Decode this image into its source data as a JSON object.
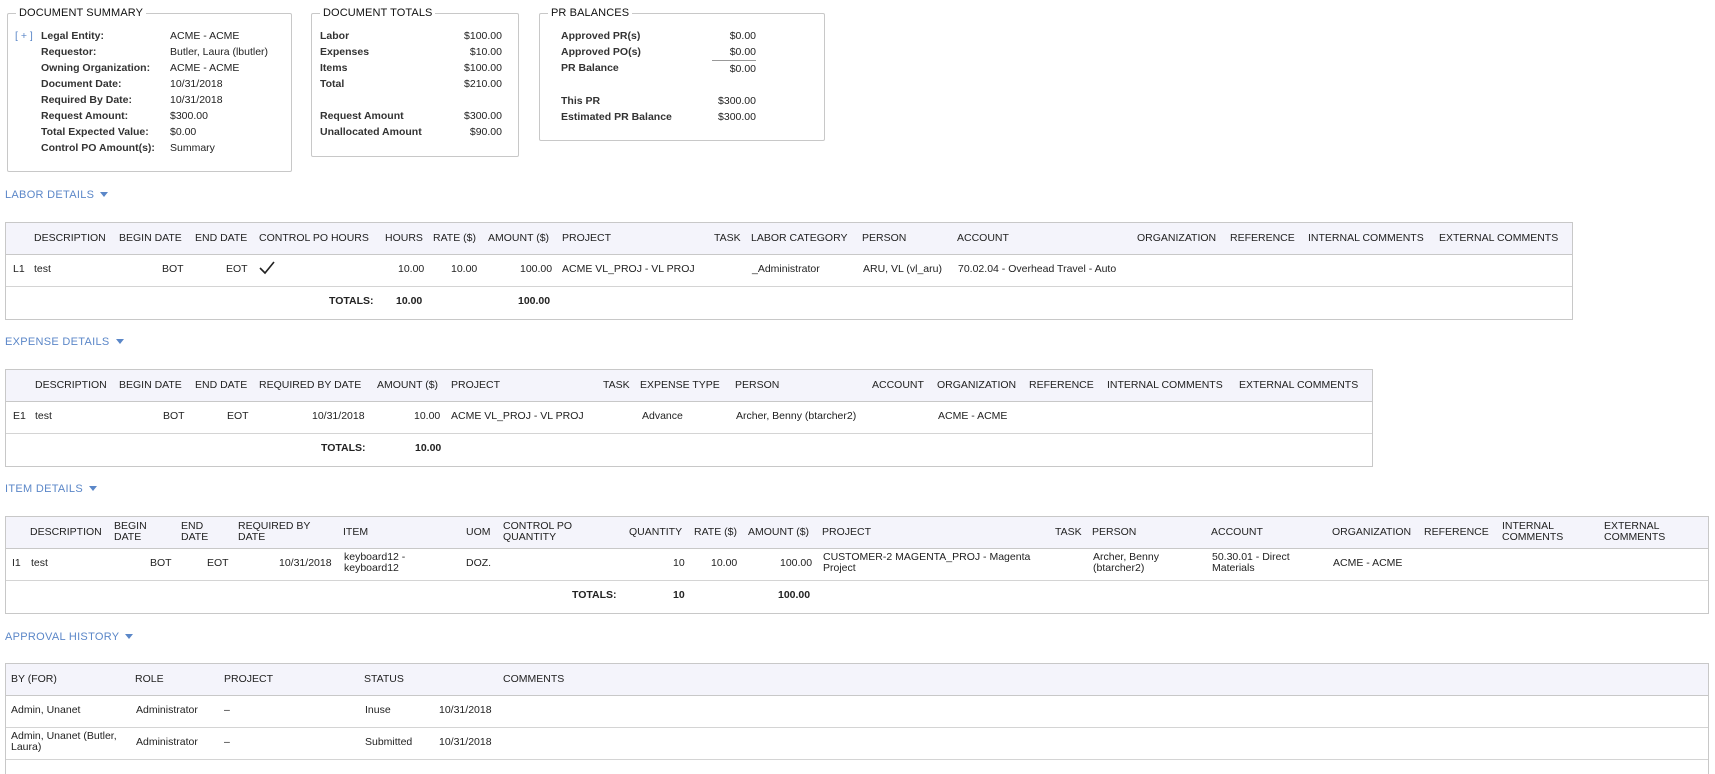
{
  "summary": {
    "title": "DOCUMENT SUMMARY",
    "expand_label": "[ + ]",
    "rows": [
      {
        "label": "Legal Entity:",
        "value": "ACME - ACME"
      },
      {
        "label": "Requestor:",
        "value": "Butler, Laura (lbutler)"
      },
      {
        "label": "Owning Organization:",
        "value": "ACME - ACME"
      },
      {
        "label": "Document Date:",
        "value": "10/31/2018"
      },
      {
        "label": "Required By Date:",
        "value": "10/31/2018"
      },
      {
        "label": "Request Amount:",
        "value": "$300.00"
      },
      {
        "label": "Total Expected Value:",
        "value": "$0.00"
      },
      {
        "label": "Control PO Amount(s):",
        "value": "Summary"
      }
    ]
  },
  "totals": {
    "title": "DOCUMENT TOTALS",
    "rows": [
      {
        "label": "Labor",
        "value": "$100.00"
      },
      {
        "label": "Expenses",
        "value": "$10.00"
      },
      {
        "label": "Items",
        "value": "$100.00"
      },
      {
        "label": "Total",
        "value": "$210.00"
      },
      {
        "label": "Request Amount",
        "value": "$300.00"
      },
      {
        "label": "Unallocated Amount",
        "value": "$90.00"
      }
    ]
  },
  "balances": {
    "title": "PR BALANCES",
    "rows": [
      {
        "label": "Approved PR(s)",
        "value": "$0.00"
      },
      {
        "label": "Approved PO(s)",
        "value": "$0.00"
      },
      {
        "label": "PR Balance",
        "value": "$0.00"
      },
      {
        "label": "This PR",
        "value": "$300.00"
      },
      {
        "label": "Estimated PR Balance",
        "value": "$300.00"
      }
    ]
  },
  "labor": {
    "section_label": "LABOR DETAILS",
    "headers": {
      "description": "DESCRIPTION",
      "begin_date": "BEGIN DATE",
      "end_date": "END DATE",
      "control_po_hours": "CONTROL PO HOURS",
      "hours": "HOURS",
      "rate": "RATE ($)",
      "amount": "AMOUNT ($)",
      "project": "PROJECT",
      "task": "TASK",
      "labor_category": "LABOR CATEGORY",
      "person": "PERSON",
      "account": "ACCOUNT",
      "organization": "ORGANIZATION",
      "reference": "REFERENCE",
      "internal_comments": "INTERNAL COMMENTS",
      "external_comments": "EXTERNAL COMMENTS"
    },
    "row": {
      "id": "L1",
      "description": "test",
      "begin_date": "BOT",
      "end_date": "EOT",
      "hours": "10.00",
      "rate": "10.00",
      "amount": "100.00",
      "project": "ACME VL_PROJ - VL PROJ",
      "labor_category": "_Administrator",
      "person": "ARU, VL (vl_aru)",
      "account": "70.02.04 - Overhead Travel - Auto"
    },
    "totals": {
      "label": "TOTALS:",
      "hours": "10.00",
      "amount": "100.00"
    }
  },
  "expense": {
    "section_label": "EXPENSE DETAILS",
    "headers": {
      "description": "DESCRIPTION",
      "begin_date": "BEGIN DATE",
      "end_date": "END DATE",
      "required_by_date": "REQUIRED BY DATE",
      "amount": "AMOUNT ($)",
      "project": "PROJECT",
      "task": "TASK",
      "expense_type": "EXPENSE TYPE",
      "person": "PERSON",
      "account": "ACCOUNT",
      "organization": "ORGANIZATION",
      "reference": "REFERENCE",
      "internal_comments": "INTERNAL COMMENTS",
      "external_comments": "EXTERNAL COMMENTS"
    },
    "row": {
      "id": "E1",
      "description": "test",
      "begin_date": "BOT",
      "end_date": "EOT",
      "required_by_date": "10/31/2018",
      "amount": "10.00",
      "project": "ACME VL_PROJ - VL PROJ",
      "expense_type": "Advance",
      "person": "Archer, Benny (btarcher2)",
      "organization": "ACME - ACME"
    },
    "totals": {
      "label": "TOTALS:",
      "amount": "10.00"
    }
  },
  "item": {
    "section_label": "ITEM DETAILS",
    "headers": {
      "description": "DESCRIPTION",
      "begin_date": "BEGIN DATE",
      "end_date": "END DATE",
      "required_by_date": "REQUIRED BY DATE",
      "item": "ITEM",
      "uom": "UOM",
      "control_po_quantity": "CONTROL PO QUANTITY",
      "quantity": "QUANTITY",
      "rate": "RATE ($)",
      "amount": "AMOUNT ($)",
      "project": "PROJECT",
      "task": "TASK",
      "person": "PERSON",
      "account": "ACCOUNT",
      "organization": "ORGANIZATION",
      "reference": "REFERENCE",
      "internal_comments": "INTERNAL COMMENTS",
      "external_comments": "EXTERNAL COMMENTS"
    },
    "row": {
      "id": "I1",
      "description": "test",
      "begin_date": "BOT",
      "end_date": "EOT",
      "required_by_date": "10/31/2018",
      "item": "keyboard12 - keyboard12",
      "uom": "DOZ.",
      "quantity": "10",
      "rate": "10.00",
      "amount": "100.00",
      "project": "CUSTOMER-2 MAGENTA_PROJ - Magenta Project",
      "person": "Archer, Benny (btarcher2)",
      "account": "50.30.01 - Direct Materials",
      "organization": "ACME - ACME"
    },
    "totals": {
      "label": "TOTALS:",
      "quantity": "10",
      "amount": "100.00"
    }
  },
  "approval": {
    "section_label": "APPROVAL HISTORY",
    "headers": {
      "by": "BY (FOR)",
      "role": "ROLE",
      "project": "PROJECT",
      "status": "STATUS",
      "comments": "COMMENTS"
    },
    "rows": [
      {
        "by": "Admin, Unanet",
        "role": "Administrator",
        "project": "–",
        "status": "Inuse",
        "date": "10/31/2018"
      },
      {
        "by": "Admin, Unanet (Butler, Laura)",
        "role": "Administrator",
        "project": "–",
        "status": "Submitted",
        "date": "10/31/2018"
      }
    ]
  }
}
